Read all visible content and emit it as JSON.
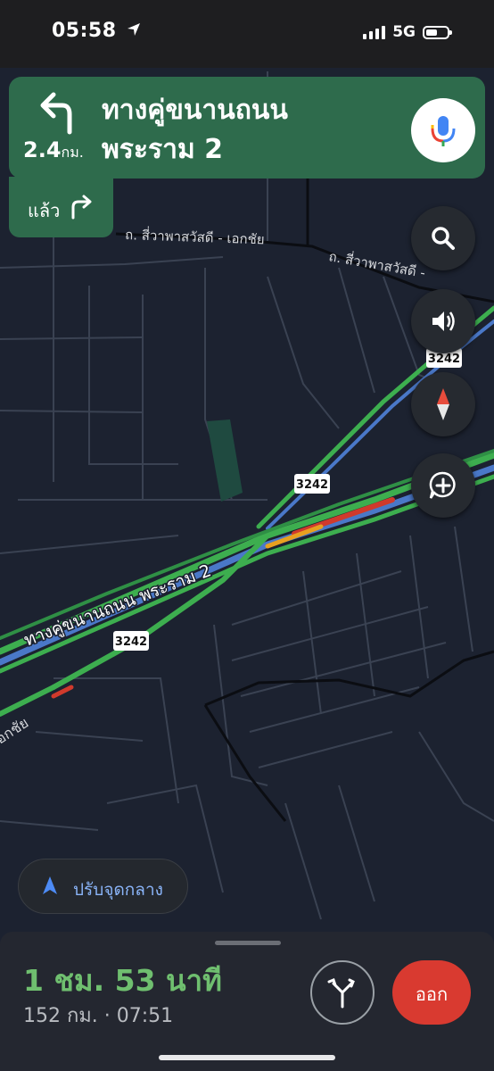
{
  "status_bar": {
    "time": "05:58",
    "network": "5G",
    "icons": [
      "location-arrow-icon",
      "signal-icon",
      "battery-icon"
    ]
  },
  "navigation": {
    "distance": "2.4",
    "distance_unit": "กม.",
    "street_line1": "ทางคู่ขนานถนน",
    "street_line2": "พระราม 2",
    "then_label": "แล้ว",
    "maneuver_icon": "turn-left-icon",
    "then_icon": "turn-right-icon"
  },
  "map": {
    "road_label_main": "ทางคู่ขนานถนน พระราม 2",
    "road_label_top1": "ถ. สี่วาพาสวัสดี - เอกชัย",
    "road_label_top2": "ถ. สี่วาพาสวัสดี -",
    "road_label_left": "อกชัย",
    "route_badges": [
      "3242",
      "3242",
      "3242"
    ],
    "colors": {
      "background": "#1c2230",
      "route_green": "#3dae4f",
      "route_blue": "#4a78c8",
      "traffic_orange": "#e8a020",
      "traffic_red": "#d03a2c",
      "nav_card": "#2e6b4c"
    }
  },
  "controls": {
    "search_icon": "search-icon",
    "sound_icon": "speaker-icon",
    "compass_icon": "compass-icon",
    "report_icon": "add-report-icon"
  },
  "recenter": {
    "label": "ปรับจุดกลาง",
    "icon": "navigation-arrow-icon"
  },
  "trip": {
    "duration": "1 ชม. 53 นาที",
    "distance_eta": "152 กม. · 07:51",
    "exit_label": "ออก",
    "alt_routes_icon": "alternate-routes-icon"
  }
}
